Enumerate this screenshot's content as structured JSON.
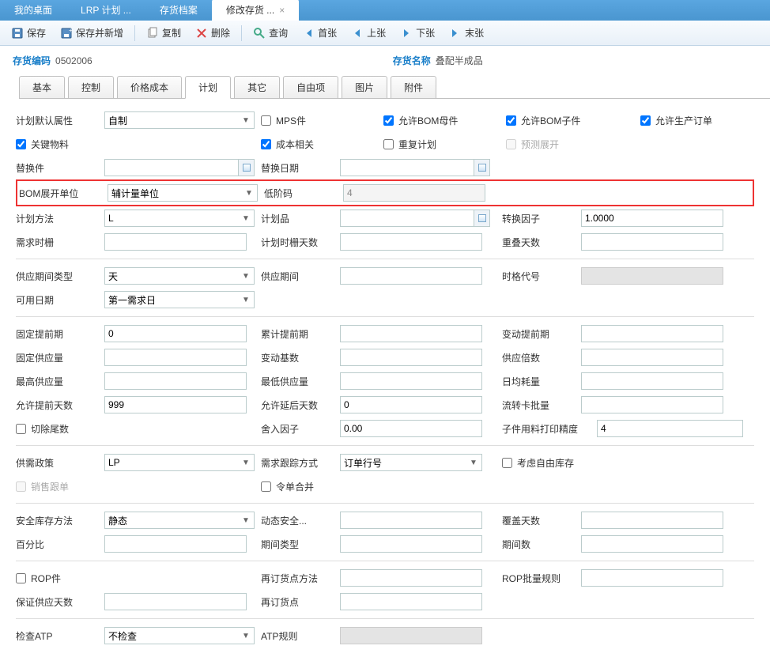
{
  "mainTabs": {
    "t0": "我的桌面",
    "t1": "LRP 计划 ...",
    "t2": "存货档案",
    "t3": "修改存货 ...",
    "closeX": "×"
  },
  "toolbar": {
    "save": "保存",
    "saveNew": "保存并新增",
    "copy": "复制",
    "delete": "删除",
    "query": "查询",
    "first": "首张",
    "prev": "上张",
    "next": "下张",
    "last": "末张"
  },
  "header": {
    "codeLabel": "存货编码",
    "codeVal": "0502006",
    "nameLabel": "存货名称",
    "nameVal": "叠配半成品"
  },
  "subTabs": {
    "basic": "基本",
    "control": "控制",
    "cost": "价格成本",
    "plan": "计划",
    "other": "其它",
    "free": "自由项",
    "pic": "图片",
    "attach": "附件"
  },
  "labels": {
    "planDefault": "计划默认属性",
    "keyMat": "关键物料",
    "replace": "替换件",
    "bomUnit": "BOM展开单位",
    "planMethod": "计划方法",
    "demandFence": "需求时栅",
    "mps": "MPS件",
    "costRel": "成本相关",
    "replDate": "替换日期",
    "lowCode": "低阶码",
    "planItem": "计划品",
    "planFenceDays": "计划时栅天数",
    "allowBomParent": "允许BOM母件",
    "replan": "重复计划",
    "allowBomChild": "允许BOM子件",
    "forecastExpand": "预测展开",
    "convFactor": "转换因子",
    "recountDays": "重叠天数",
    "allowProdOrder": "允许生产订单",
    "supplyPeriodType": "供应期间类型",
    "availDate": "可用日期",
    "supplyPeriod": "供应期间",
    "timeCode": "时格代号",
    "fixedLead": "固定提前期",
    "fixedSupply": "固定供应量",
    "maxSupply": "最高供应量",
    "allowEarlyDays": "允许提前天数",
    "cutTail": "切除尾数",
    "cumLead": "累计提前期",
    "varBase": "变动基数",
    "minSupply": "最低供应量",
    "allowLateDays": "允许延后天数",
    "roundFactor": "舍入因子",
    "varLead": "变动提前期",
    "supplyMult": "供应倍数",
    "dailyCons": "日均耗量",
    "flowBatch": "流转卡批量",
    "childPrintPrec": "子件用料打印精度",
    "supplyPolicy": "供需政策",
    "salesTrack": "销售跟单",
    "demandTrackMode": "需求跟踪方式",
    "orderMerge": "令单合并",
    "considerFreeStock": "考虑自由库存",
    "safetyMethod": "安全库存方法",
    "percent": "百分比",
    "dynSafety": "动态安全...",
    "periodType": "期间类型",
    "coverDays": "覆盖天数",
    "periodNum": "期间数",
    "rop": "ROP件",
    "guaranteeDays": "保证供应天数",
    "reorderMethod": "再订货点方法",
    "reorderPoint": "再订货点",
    "ropBatchRule": "ROP批量规则",
    "checkATP": "检查ATP",
    "atpRule": "ATP规则"
  },
  "values": {
    "planDefault": "自制",
    "bomUnit": "辅计量单位",
    "planMethod": "L",
    "lowCode": "4",
    "convFactor": "1.0000",
    "supplyPeriodType": "天",
    "availDate": "第一需求日",
    "fixedLead": "0",
    "allowEarlyDays": "999",
    "allowLateDays": "0",
    "roundFactor": "0.00",
    "childPrintPrec": "4",
    "supplyPolicy": "LP",
    "demandTrackMode": "订单行号",
    "safetyMethod": "静态",
    "checkATP": "不检查"
  },
  "checks": {
    "keyMat": true,
    "mps": false,
    "costRel": true,
    "allowBomParent": true,
    "replan": false,
    "allowBomChild": true,
    "forecastExpand": false,
    "allowProdOrder": true,
    "cutTail": false,
    "salesTrack": false,
    "orderMerge": false,
    "considerFreeStock": false,
    "rop": false
  }
}
